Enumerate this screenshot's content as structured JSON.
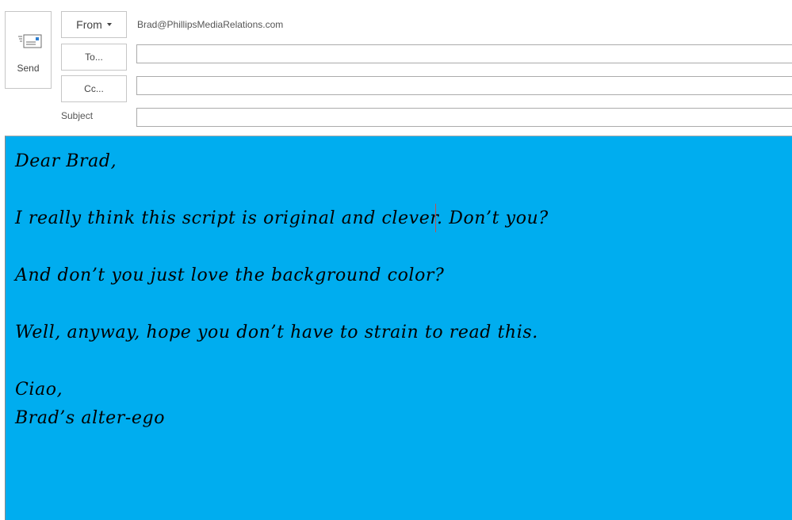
{
  "compose": {
    "send_label": "Send",
    "from_label": "From",
    "from_address": "Brad@PhillipsMediaRelations.com",
    "to_label": "To...",
    "cc_label": "Cc...",
    "subject_label": "Subject",
    "to_value": "",
    "cc_value": "",
    "subject_value": ""
  },
  "message": {
    "background_color": "#00adef",
    "text_color": "#000000",
    "lines": [
      "Dear Brad,",
      "I really think this script is original and clever. Don’t you?",
      "And don’t you just love the background color?",
      "Well, anyway, hope you don’t have to strain to read this.",
      "Ciao,",
      "Brad’s alter-ego"
    ]
  },
  "icons": {
    "send": "send-envelope-icon",
    "from_dropdown": "chevron-down-icon"
  }
}
